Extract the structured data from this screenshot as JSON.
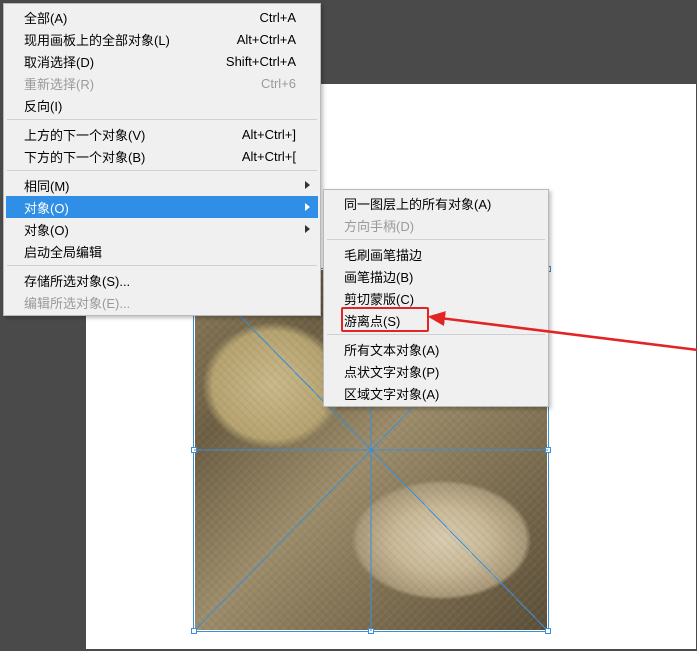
{
  "main_menu": {
    "items": [
      {
        "label": "全部(A)",
        "shortcut": "Ctrl+A"
      },
      {
        "label": "现用画板上的全部对象(L)",
        "shortcut": "Alt+Ctrl+A"
      },
      {
        "label": "取消选择(D)",
        "shortcut": "Shift+Ctrl+A"
      },
      {
        "label": "重新选择(R)",
        "shortcut": "Ctrl+6",
        "disabled": true
      },
      {
        "label": "反向(I)",
        "shortcut": ""
      }
    ],
    "items2": [
      {
        "label": "上方的下一个对象(V)",
        "shortcut": "Alt+Ctrl+]"
      },
      {
        "label": "下方的下一个对象(B)",
        "shortcut": "Alt+Ctrl+["
      }
    ],
    "items3": [
      {
        "label": "相同(M)",
        "shortcut": "",
        "submenu": true
      },
      {
        "label": "对象(O)",
        "shortcut": "",
        "submenu": true,
        "highlight": true
      },
      {
        "label": "对象(O)",
        "shortcut": "",
        "submenu": true
      },
      {
        "label": "启动全局编辑",
        "shortcut": ""
      }
    ],
    "items4": [
      {
        "label": "存储所选对象(S)...",
        "shortcut": ""
      },
      {
        "label": "编辑所选对象(E)...",
        "shortcut": "",
        "disabled": true
      }
    ]
  },
  "sub_menu": {
    "items": [
      {
        "label": "同一图层上的所有对象(A)"
      },
      {
        "label": "方向手柄(D)",
        "disabled": true
      }
    ],
    "items2": [
      {
        "label": "毛刷画笔描边"
      },
      {
        "label": "画笔描边(B)"
      },
      {
        "label": "剪切蒙版(C)"
      },
      {
        "label": "游离点(S)"
      }
    ],
    "items3": [
      {
        "label": "所有文本对象(A)"
      },
      {
        "label": "点状文字对象(P)"
      },
      {
        "label": "区域文字对象(A)"
      }
    ]
  },
  "annotation": {
    "highlight_target": "游离点(S)"
  }
}
